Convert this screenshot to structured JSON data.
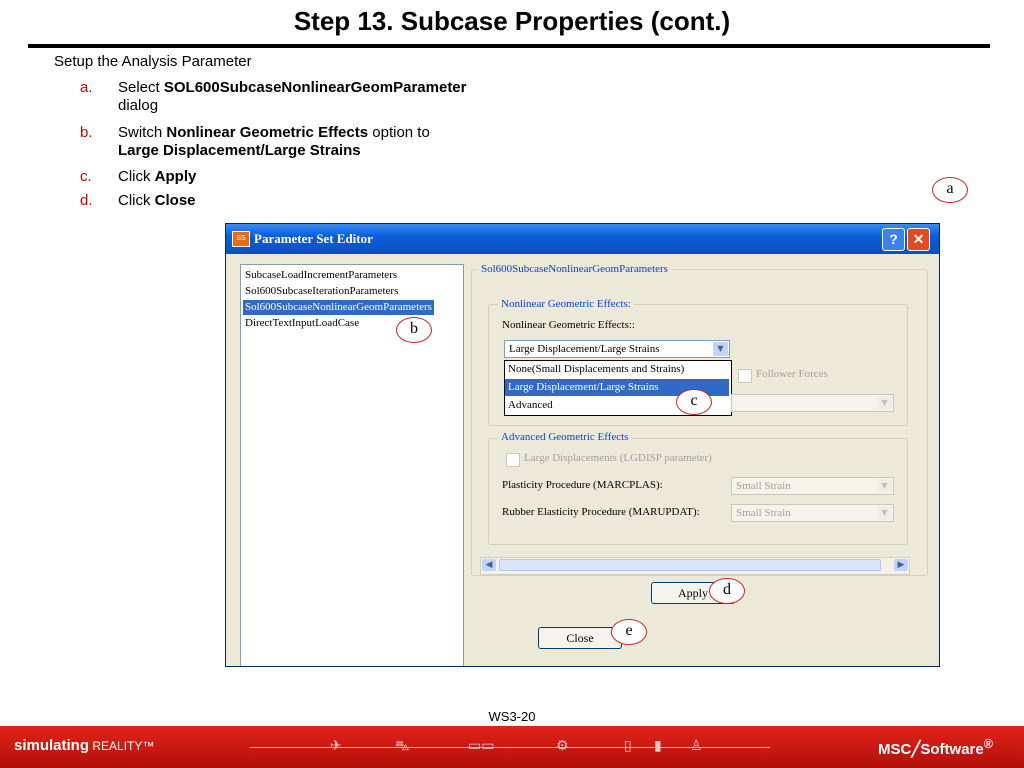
{
  "slide": {
    "title": "Step 13. Subcase Properties (cont.)",
    "intro": "Setup the Analysis Parameter",
    "steps": [
      {
        "letter": "a.",
        "pre": "Select ",
        "bold": "SOL600SubcaseNonlinearGeomParameter",
        "post": "",
        "line2_text": "dialog",
        "line2_bold": ""
      },
      {
        "letter": "b.",
        "pre": "Switch ",
        "bold": "Nonlinear Geometric Effects",
        "post": " option to",
        "line2_text": "",
        "line2_bold": "Large Displacement/Large Strains"
      },
      {
        "letter": "c.",
        "pre": "Click ",
        "bold": "Apply",
        "post": "",
        "line2_text": "",
        "line2_bold": ""
      },
      {
        "letter": "d.",
        "pre": "Click ",
        "bold": "Close",
        "post": "",
        "line2_text": "",
        "line2_bold": ""
      }
    ],
    "callouts": [
      "a",
      "b",
      "c",
      "d",
      "e"
    ],
    "page_number": "WS3-20"
  },
  "dialog": {
    "title": "Parameter Set Editor",
    "icon_text": "SS",
    "help_icon": "question-icon",
    "close_icon": "close-icon",
    "parameter_list": [
      "SubcaseLoadIncrementParameters",
      "Sol600SubcaseIterationParameters",
      "Sol600SubcaseNonlinearGeomParameters",
      "DirectTextInputLoadCase"
    ],
    "selected_parameter_index": 2,
    "panel_title": "Sol600SubcaseNonlinearGeomParameters",
    "nonlinear_group": {
      "title": "Nonlinear Geometric Effects:",
      "field_label": "Nonlinear Geometric Effects::",
      "selected": "Large Displacement/Large Strains",
      "options": [
        "None(Small Displacements and Strains)",
        "Large Displacement/Large Strains",
        "Advanced"
      ],
      "highlighted_option_index": 1,
      "follower_forces_label": "Follower Forces"
    },
    "advanced_group": {
      "title": "Advanced Geometric Effects",
      "large_disp_label": "Large Displacements (LGDISP parameter)",
      "plasticity_label": "Plasticity Procedure (MARCPLAS):",
      "plasticity_value": "Small Strain",
      "rubber_label": "Rubber Elasticity Procedure (MARUPDAT):",
      "rubber_value": "Small Strain"
    },
    "apply_label": "Apply",
    "close_label": "Close",
    "dropdown_arrow": "▼",
    "scroll_left": "◀",
    "scroll_right": "▶"
  },
  "footer": {
    "slogan_bold": "simulating",
    "slogan_rest": " REALITY™",
    "logo": "MSC╱Software",
    "logo_suffix": "®",
    "icons": [
      "airplane-icon",
      "car-icon",
      "train-icon",
      "gear-icon",
      "phone-icon",
      "bottle-icon",
      "person-icon"
    ]
  },
  "colors": {
    "accent_red": "#cc0000",
    "footer_red": "#d01a12",
    "selection_blue": "#316ac5",
    "group_title_blue": "#0046d5"
  }
}
